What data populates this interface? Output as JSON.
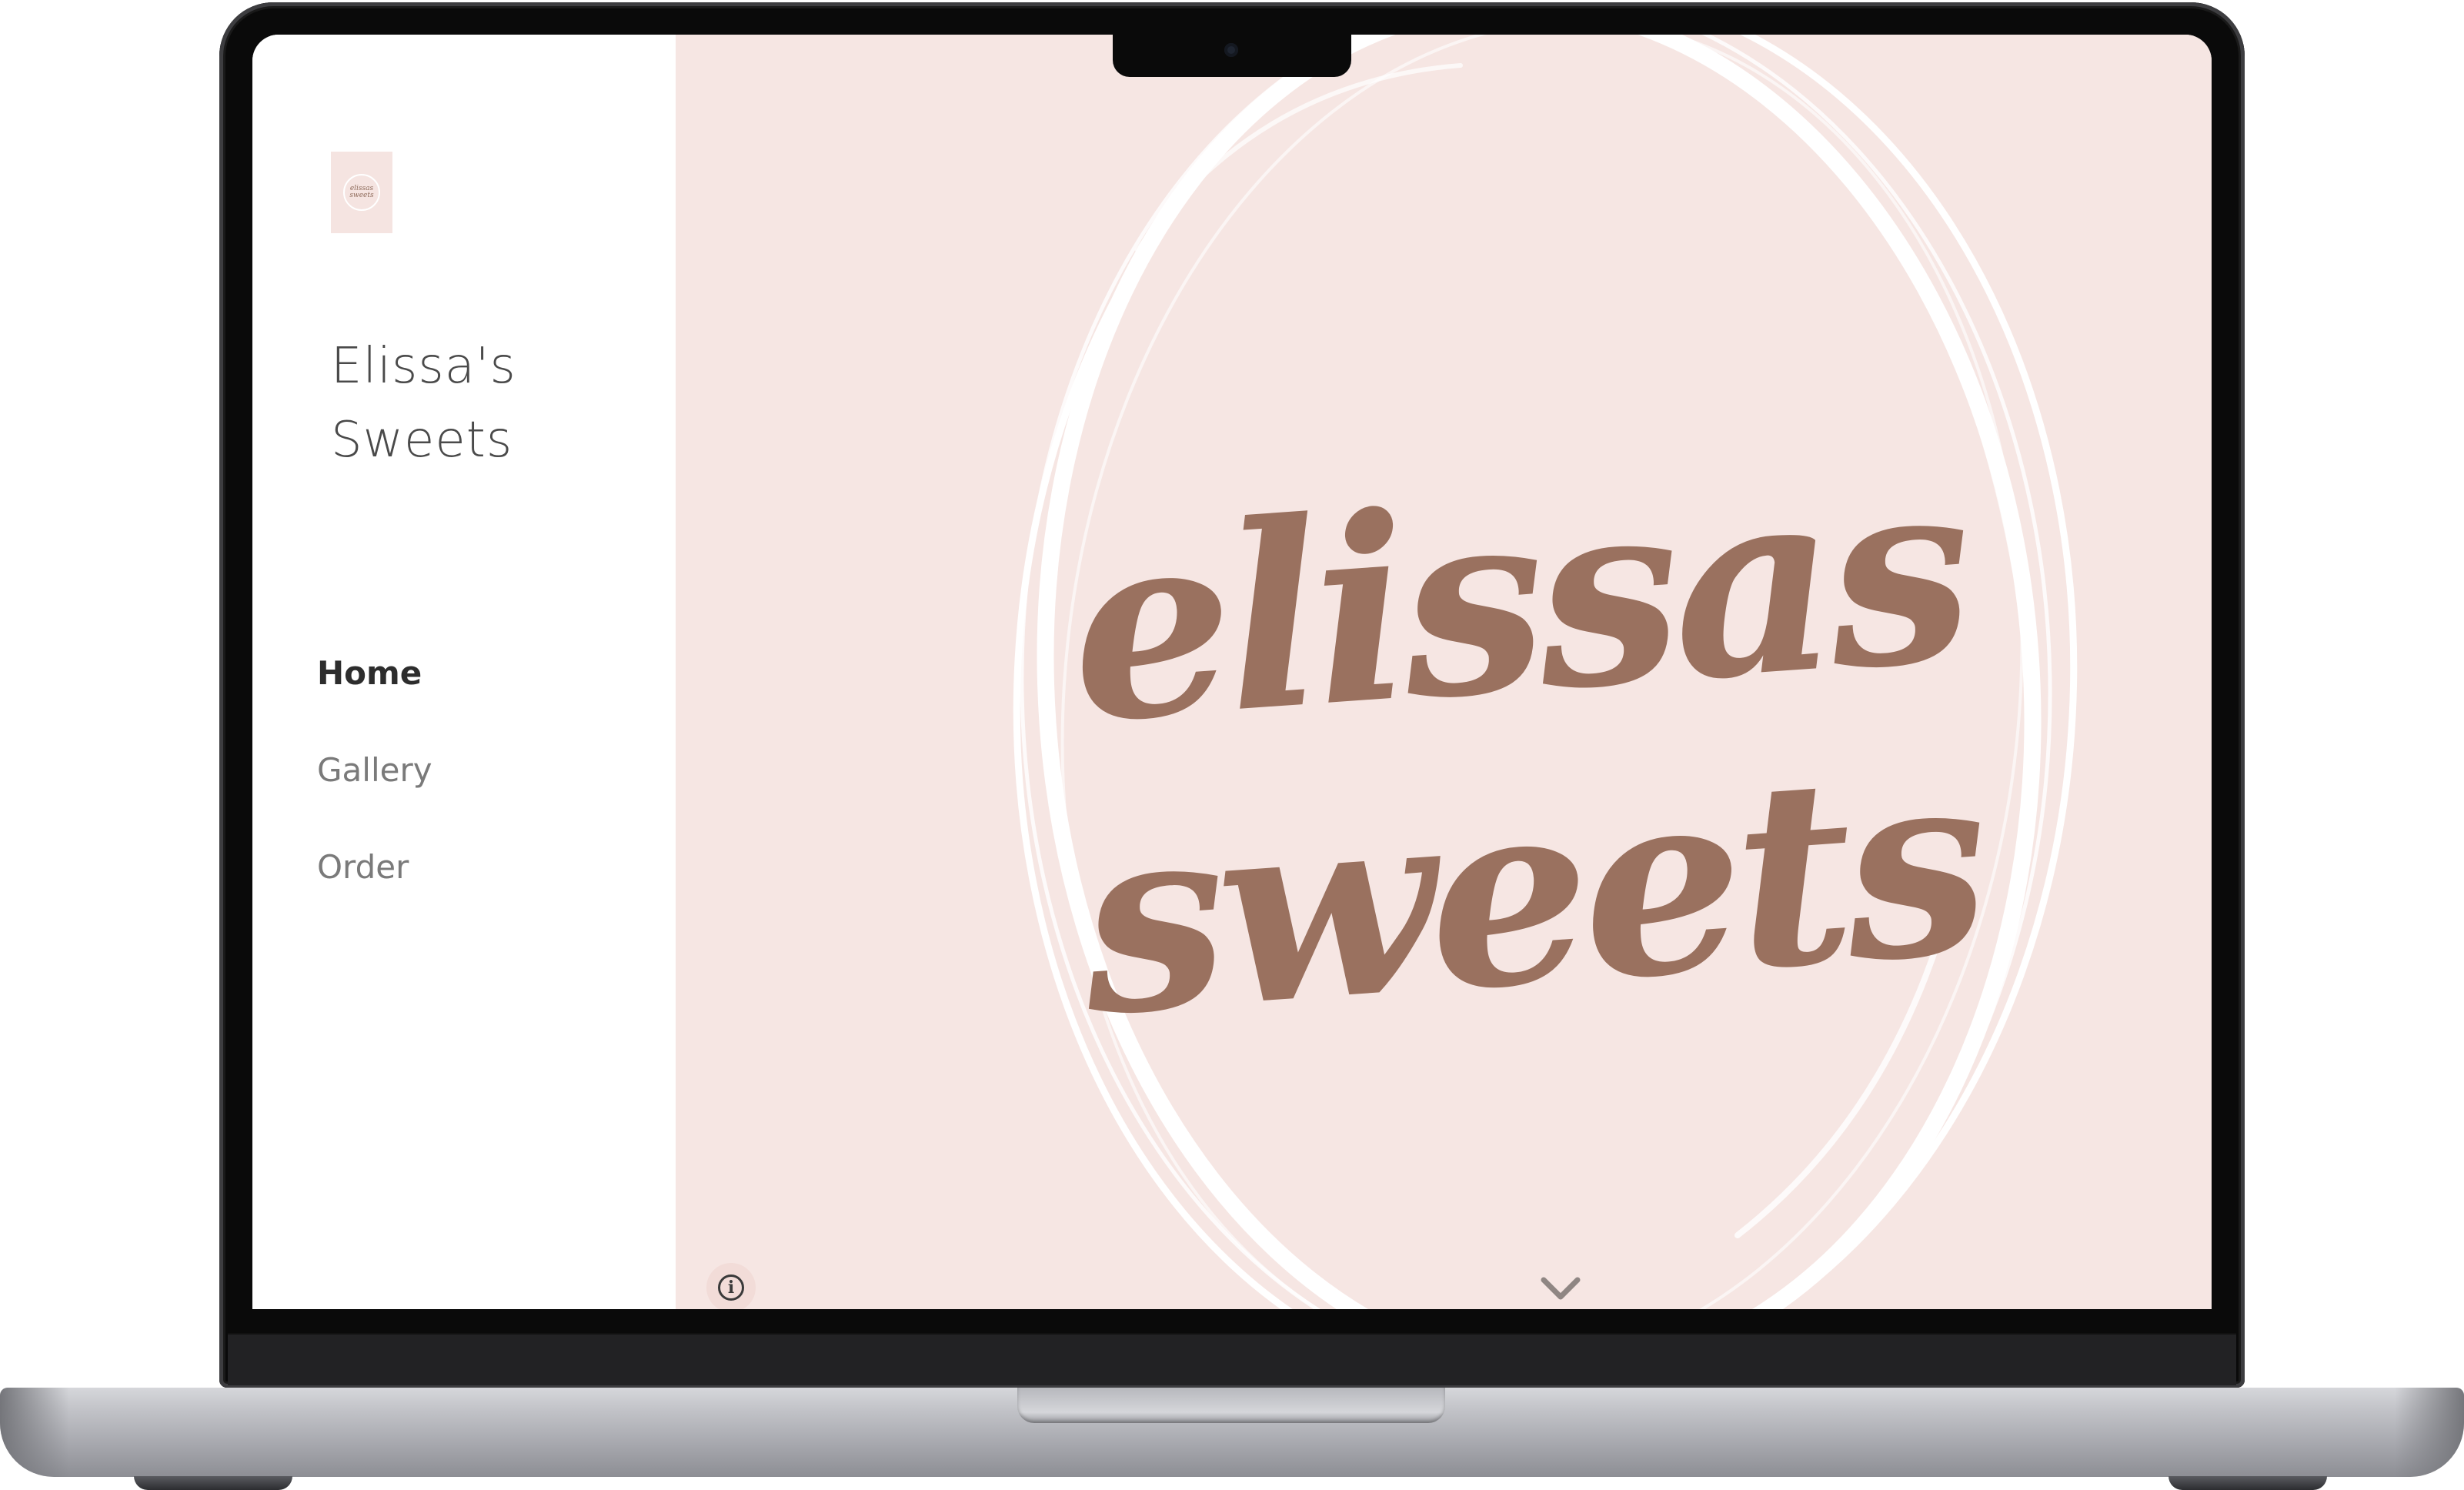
{
  "site": {
    "title": "Elissa's Sweets",
    "title_line1": "Elissa's",
    "title_line2": "Sweets",
    "logo_text_line1": "elissas",
    "logo_text_line2": "sweets"
  },
  "nav": {
    "items": [
      {
        "label": "Home",
        "active": true
      },
      {
        "label": "Gallery",
        "active": false
      },
      {
        "label": "Order",
        "active": false
      }
    ]
  },
  "hero": {
    "logo_word1": "elissas",
    "logo_word2": "sweets",
    "info_label": "i"
  },
  "colors": {
    "hero_background": "#f6e6e3",
    "logo_brown": "#9a715f",
    "sidebar_background": "#ffffff",
    "nav_active": "#2d2d2d",
    "nav_inactive": "#7a7a7a"
  },
  "icons": {
    "info": "info-icon",
    "scroll": "chevron-down-icon"
  }
}
